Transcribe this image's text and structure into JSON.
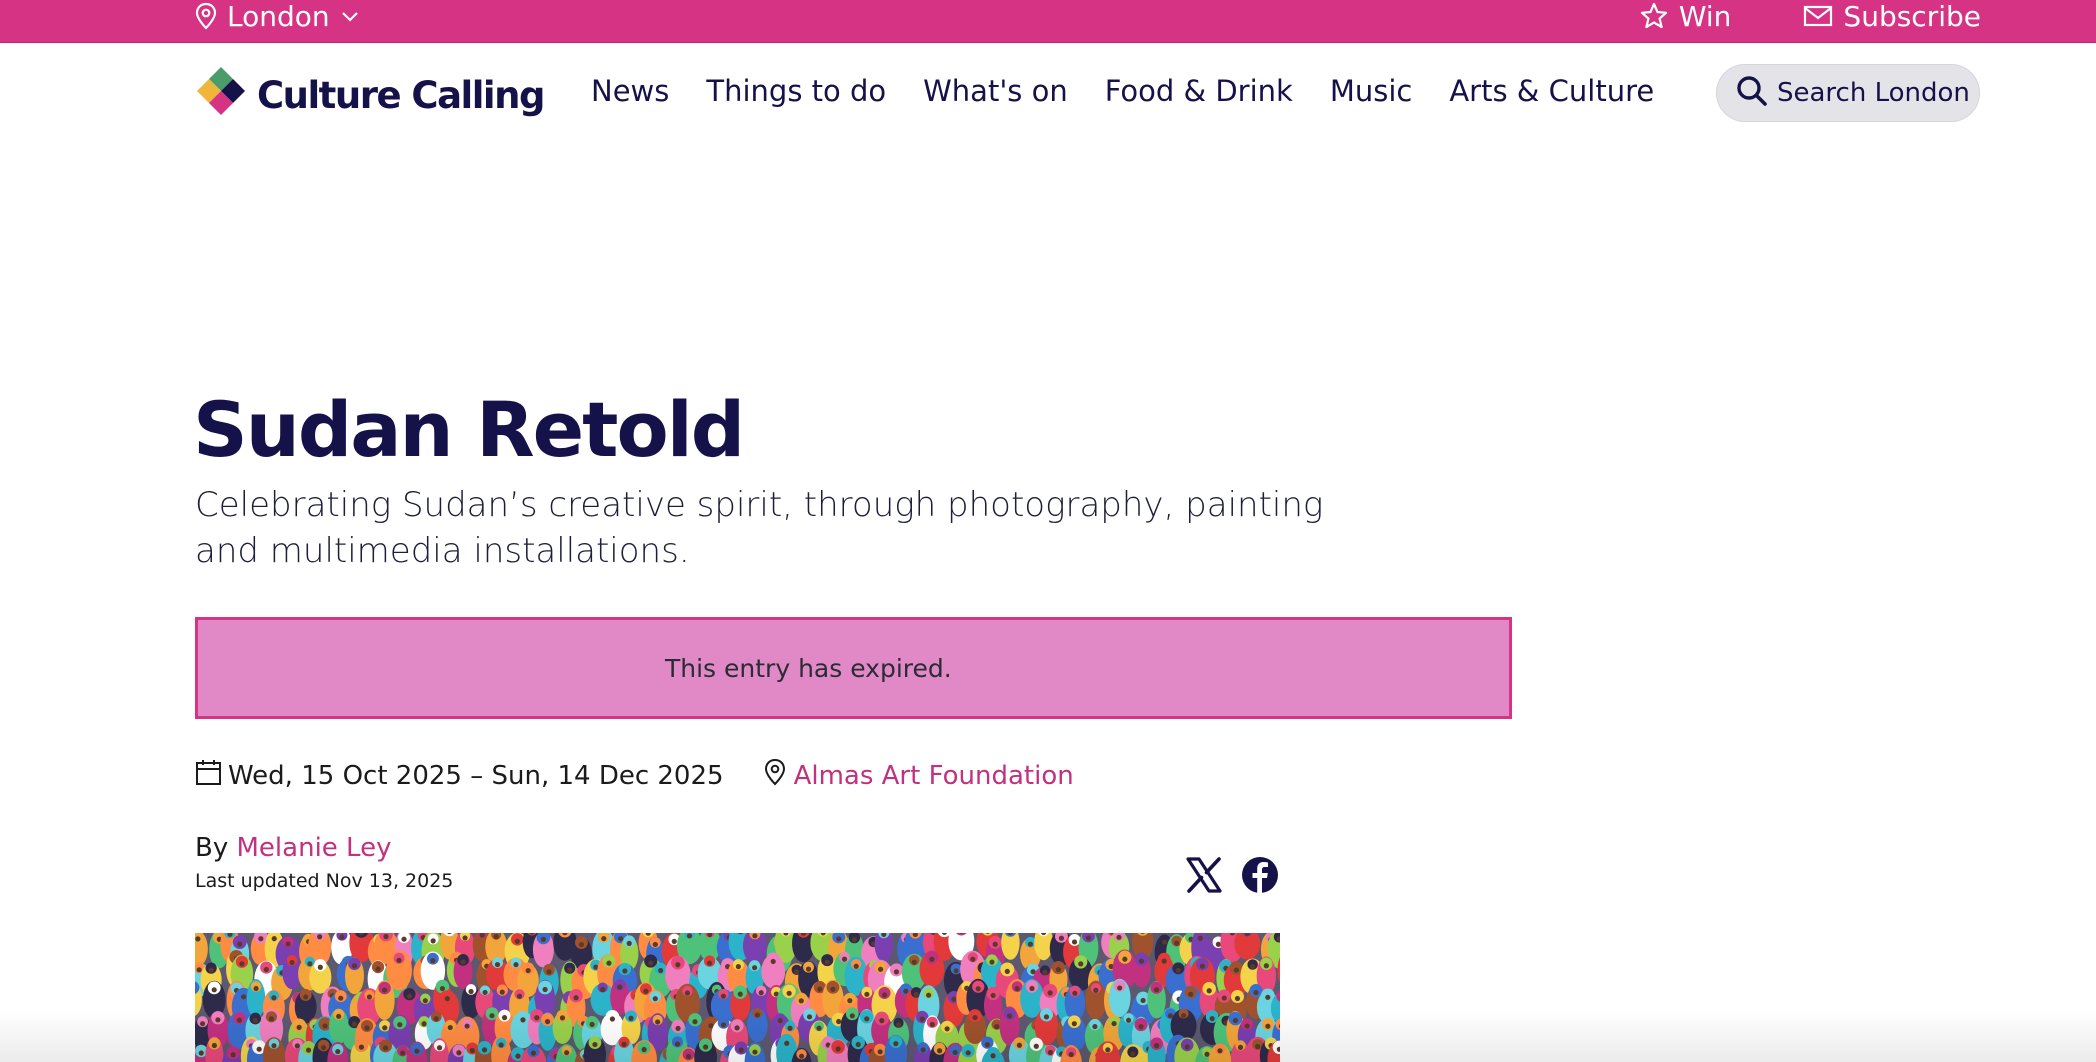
{
  "topbar": {
    "location": "London",
    "win": "Win",
    "subscribe": "Subscribe",
    "background": "#d63384"
  },
  "header": {
    "logo_text": "Culture Calling",
    "nav": [
      {
        "label": "News"
      },
      {
        "label": "Things to do"
      },
      {
        "label": "What's on"
      },
      {
        "label": "Food & Drink"
      },
      {
        "label": "Music"
      },
      {
        "label": "Arts & Culture"
      }
    ],
    "search_label": "Search London"
  },
  "article": {
    "title": "Sudan Retold",
    "subtitle": "Celebrating Sudan’s creative spirit, through photography, painting and multimedia installations.",
    "expired_notice": "This entry has expired.",
    "dates": "Wed, 15 Oct 2025 – Sun, 14 Dec 2025",
    "venue": "Almas Art Foundation",
    "by_prefix": "By",
    "author": "Melanie Ley",
    "last_updated": "Last updated Nov 13, 2025"
  },
  "colors": {
    "brand_pink": "#d63384",
    "navy": "#15124a",
    "expired_bg": "#e089c6",
    "link": "#c2317f"
  },
  "icons": {
    "location": "map-pin-icon",
    "dropdown": "chevron-down-icon",
    "win": "star-icon",
    "subscribe": "envelope-icon",
    "search": "search-icon",
    "calendar": "calendar-icon",
    "venue": "map-pin-icon",
    "share_x": "x-logo-icon",
    "share_facebook": "facebook-icon"
  }
}
